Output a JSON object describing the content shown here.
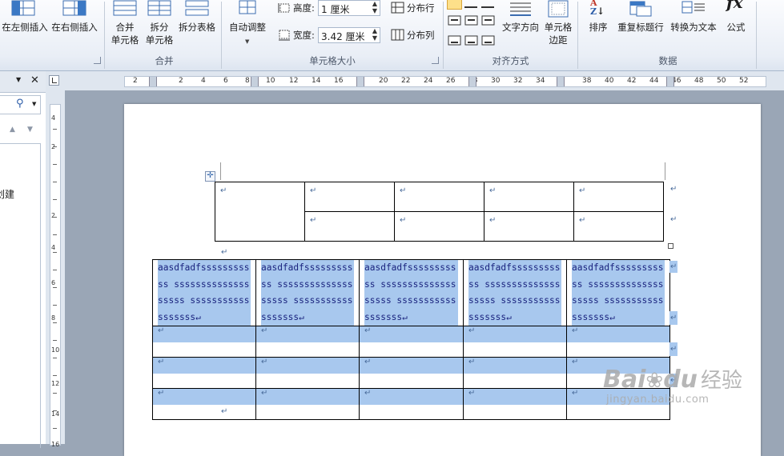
{
  "ribbon": {
    "insert": {
      "left_label": "在左侧插入",
      "right_label": "在右侧插入"
    },
    "merge": {
      "merge_cells": [
        "合并",
        "单元格"
      ],
      "split_cells": [
        "拆分",
        "单元格"
      ],
      "split_table": "拆分表格",
      "group_label": "合并"
    },
    "cell_size": {
      "autofit": "自动调整",
      "height_label": "高度:",
      "height_value": "1 厘米",
      "width_label": "宽度:",
      "width_value": "3.42 厘米",
      "distribute_rows": "分布行",
      "distribute_cols": "分布列",
      "group_label": "单元格大小"
    },
    "alignment": {
      "text_direction": "文字方向",
      "cell_margins": [
        "单元格",
        "边距"
      ],
      "group_label": "对齐方式"
    },
    "data": {
      "sort": "排序",
      "repeat_header": "重复标题行",
      "convert_to_text": "转换为文本",
      "formula": "公式",
      "formula_icon": "fx",
      "group_label": "数据"
    }
  },
  "left_panel": {
    "close": "✕",
    "partial_text": "创建"
  },
  "hruler": {
    "numbers": [
      "2",
      "2",
      "4",
      "6",
      "8",
      "10",
      "12",
      "14",
      "16",
      "20",
      "22",
      "24",
      "26",
      "28",
      "30",
      "32",
      "34",
      "38",
      "40",
      "42",
      "44",
      "46",
      "48",
      "50",
      "52"
    ]
  },
  "vruler": {
    "numbers": [
      "4",
      "2",
      "2",
      "4",
      "6",
      "8",
      "10",
      "12",
      "14",
      "16"
    ]
  },
  "document": {
    "paragraph_mark": "↵",
    "table1": {
      "rows": [
        [
          "↵",
          "↵",
          "↵",
          "↵",
          "↵"
        ],
        [
          "",
          "↵",
          "↵",
          "↵",
          "↵"
        ]
      ]
    },
    "table2": {
      "header_text": "aasdfadfsssssssssss sssssssssssssssssss ssssssssssssssssss↵",
      "rows": [
        [
          "↵",
          "↵",
          "↵",
          "↵",
          "↵"
        ],
        [
          "↵",
          "↵",
          "↵",
          "↵",
          "↵"
        ],
        [
          "↵",
          "↵",
          "↵",
          "↵",
          "↵"
        ]
      ]
    }
  },
  "watermark": {
    "brand": "Bai",
    "brand2": "du",
    "cn": "经验",
    "url": "jingyan.baidu.com"
  }
}
